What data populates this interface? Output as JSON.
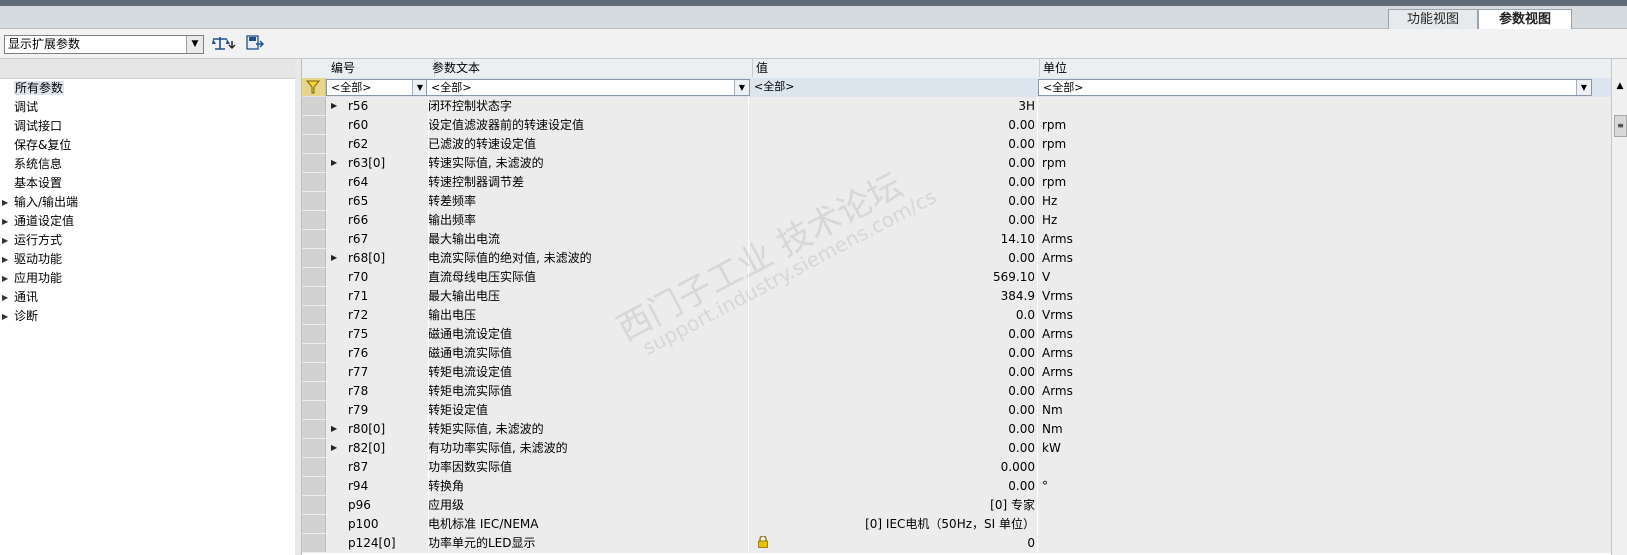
{
  "tabs": [
    {
      "label": "功能视图",
      "active": false
    },
    {
      "label": "参数视图",
      "active": true
    }
  ],
  "toolbar": {
    "view_combo_value": "显示扩展参数",
    "icons": [
      "balance-expand-icon",
      "save-export-icon"
    ]
  },
  "nav": {
    "items": [
      {
        "label": "所有参数",
        "expandable": false,
        "selected": true
      },
      {
        "label": "调试",
        "expandable": false
      },
      {
        "label": "调试接口",
        "expandable": false
      },
      {
        "label": "保存&复位",
        "expandable": false
      },
      {
        "label": "系统信息",
        "expandable": false
      },
      {
        "label": "基本设置",
        "expandable": false
      },
      {
        "label": "输入/输出端",
        "expandable": true
      },
      {
        "label": "通道设定值",
        "expandable": true
      },
      {
        "label": "运行方式",
        "expandable": true
      },
      {
        "label": "驱动功能",
        "expandable": true
      },
      {
        "label": "应用功能",
        "expandable": true
      },
      {
        "label": "通讯",
        "expandable": true
      },
      {
        "label": "诊断",
        "expandable": true
      }
    ]
  },
  "grid": {
    "columns": [
      "编号",
      "参数文本",
      "值",
      "单位"
    ],
    "filter_all": "<全部>",
    "rows": [
      {
        "num": "r56",
        "text": "闭环控制状态字",
        "value": "3H",
        "unit": "",
        "expandable": true
      },
      {
        "num": "r60",
        "text": "设定值滤波器前的转速设定值",
        "value": "0.00",
        "unit": "rpm",
        "expandable": false
      },
      {
        "num": "r62",
        "text": "已滤波的转速设定值",
        "value": "0.00",
        "unit": "rpm",
        "expandable": false
      },
      {
        "num": "r63[0]",
        "text": "转速实际值, 未滤波的",
        "value": "0.00",
        "unit": "rpm",
        "expandable": true
      },
      {
        "num": "r64",
        "text": "转速控制器调节差",
        "value": "0.00",
        "unit": "rpm",
        "expandable": false
      },
      {
        "num": "r65",
        "text": "转差频率",
        "value": "0.00",
        "unit": "Hz",
        "expandable": false
      },
      {
        "num": "r66",
        "text": "输出频率",
        "value": "0.00",
        "unit": "Hz",
        "expandable": false
      },
      {
        "num": "r67",
        "text": "最大输出电流",
        "value": "14.10",
        "unit": "Arms",
        "expandable": false
      },
      {
        "num": "r68[0]",
        "text": "电流实际值的绝对值, 未滤波的",
        "value": "0.00",
        "unit": "Arms",
        "expandable": true
      },
      {
        "num": "r70",
        "text": "直流母线电压实际值",
        "value": "569.10",
        "unit": "V",
        "expandable": false
      },
      {
        "num": "r71",
        "text": "最大输出电压",
        "value": "384.9",
        "unit": "Vrms",
        "expandable": false
      },
      {
        "num": "r72",
        "text": "输出电压",
        "value": "0.0",
        "unit": "Vrms",
        "expandable": false
      },
      {
        "num": "r75",
        "text": "磁通电流设定值",
        "value": "0.00",
        "unit": "Arms",
        "expandable": false
      },
      {
        "num": "r76",
        "text": "磁通电流实际值",
        "value": "0.00",
        "unit": "Arms",
        "expandable": false
      },
      {
        "num": "r77",
        "text": "转矩电流设定值",
        "value": "0.00",
        "unit": "Arms",
        "expandable": false
      },
      {
        "num": "r78",
        "text": "转矩电流实际值",
        "value": "0.00",
        "unit": "Arms",
        "expandable": false
      },
      {
        "num": "r79",
        "text": "转矩设定值",
        "value": "0.00",
        "unit": "Nm",
        "expandable": false
      },
      {
        "num": "r80[0]",
        "text": "转矩实际值, 未滤波的",
        "value": "0.00",
        "unit": "Nm",
        "expandable": true
      },
      {
        "num": "r82[0]",
        "text": "有功功率实际值, 未滤波的",
        "value": "0.00",
        "unit": "kW",
        "expandable": true
      },
      {
        "num": "r87",
        "text": "功率因数实际值",
        "value": "0.000",
        "unit": "",
        "expandable": false
      },
      {
        "num": "r94",
        "text": "转换角",
        "value": "0.00",
        "unit": "°",
        "expandable": false
      },
      {
        "num": "p96",
        "text": "应用级",
        "value": "[0] 专家",
        "unit": "",
        "expandable": false
      },
      {
        "num": "p100",
        "text": "电机标准 IEC/NEMA",
        "value": "[0] IEC电机（50Hz，SI 单位）",
        "unit": "",
        "expandable": false
      },
      {
        "num": "p124[0]",
        "text": "功率单元的LED显示",
        "value": "0",
        "unit": "",
        "expandable": false,
        "locked": true
      }
    ]
  },
  "watermark": {
    "line1": "西门子工业  技术论坛",
    "line2": "support.industry.siemens.com/cs"
  }
}
